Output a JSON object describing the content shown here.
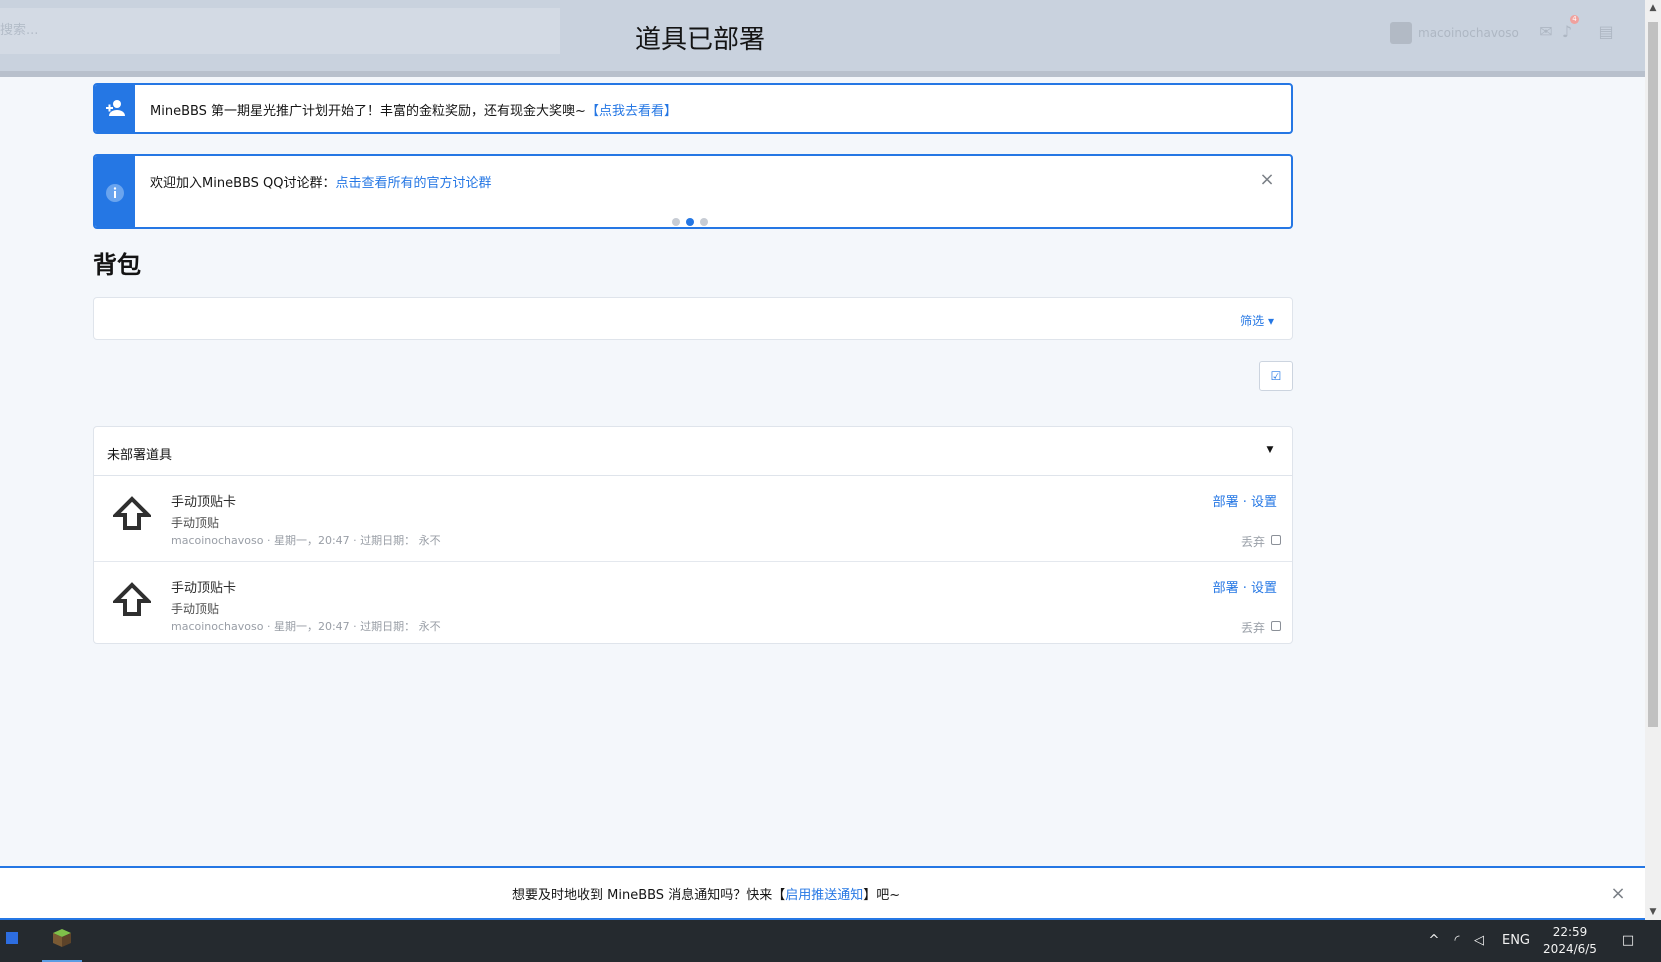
{
  "header": {
    "search_placeholder": "搜索...",
    "toast_title": "道具已部署",
    "account_name": "macoinochavoso",
    "notification_count": "4"
  },
  "notices": [
    {
      "text": "MineBBS 第一期星光推广计划开始了！丰富的金粒奖励，还有现金大奖噢~",
      "link": "【点我去看看】"
    },
    {
      "text": "欢迎加入MineBBS QQ讨论群：",
      "link": "点击查看所有的官方讨论群"
    }
  ],
  "page": {
    "title": "背包",
    "filter_label": "筛选"
  },
  "inventory": {
    "title": "未部署道具",
    "items": [
      {
        "name": "手动顶贴卡",
        "desc": "手动顶贴",
        "meta": "macoinochavoso · 星期一，20:47 · 过期日期： 永不",
        "actions": "部署 · 设置",
        "discard": "丢弃"
      },
      {
        "name": "手动顶贴卡",
        "desc": "手动顶贴",
        "meta": "macoinochavoso · 星期一，20:47 · 过期日期： 永不",
        "actions": "部署 · 设置",
        "discard": "丢弃"
      }
    ]
  },
  "push_bar": {
    "text_before": "想要及时地收到 MineBBS 消息通知吗？快来【",
    "link": "启用推送通知",
    "text_after": "】吧~"
  },
  "taskbar": {
    "language": "ENG",
    "time": "22:59",
    "date": "2024/6/5"
  },
  "icons": {
    "add-user": "add-user-icon",
    "info": "info-icon",
    "close": "close-icon",
    "checkbox": "checkbox-icon",
    "up-arrow": "up-arrow-icon"
  },
  "colors": {
    "accent": "#2577e4",
    "header_bg": "#c9d2de",
    "taskbar_bg": "#252a2f"
  }
}
